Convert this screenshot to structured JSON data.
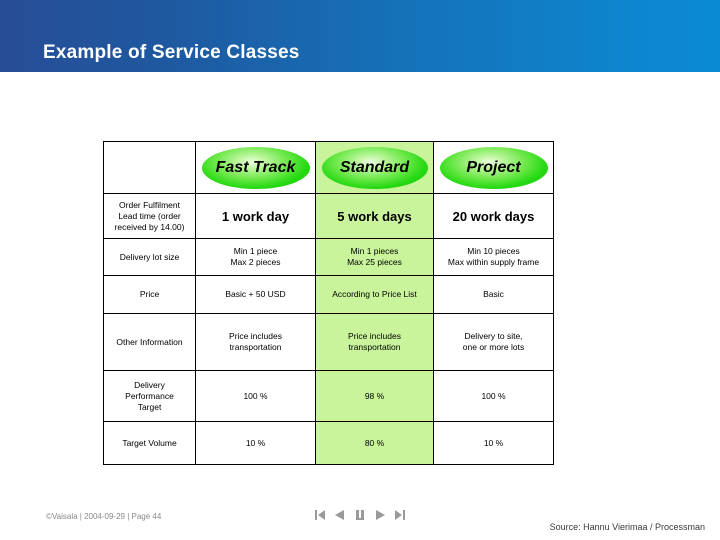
{
  "slide": {
    "title": "Example of Service Classes"
  },
  "table": {
    "columns": [
      "Fast Track",
      "Standard",
      "Project"
    ],
    "highlight_column": "Standard",
    "highlight_color": "#c9f49b",
    "pill_color": "#25d912",
    "rows": [
      {
        "label": "Order Fulfilment Lead time (order received by 14.00)",
        "label_lines": [
          "Order Fulfilment",
          "Lead time (order",
          "received by 14.00)"
        ],
        "emphasis": true,
        "cells": [
          {
            "lines": [
              "1 work day"
            ]
          },
          {
            "lines": [
              "5 work days"
            ]
          },
          {
            "lines": [
              "20 work days"
            ]
          }
        ]
      },
      {
        "label": "Delivery lot size",
        "label_lines": [
          "Delivery lot size"
        ],
        "emphasis": false,
        "cells": [
          {
            "lines": [
              "Min 1 piece",
              "Max 2 pieces"
            ]
          },
          {
            "lines": [
              "Min 1 pieces",
              "Max 25 pieces"
            ]
          },
          {
            "lines": [
              "Min 10 pieces",
              "Max within supply frame"
            ]
          }
        ]
      },
      {
        "label": "Price",
        "label_lines": [
          "Price"
        ],
        "emphasis": false,
        "cells": [
          {
            "lines": [
              "Basic + 50 USD"
            ]
          },
          {
            "lines": [
              "According to Price List"
            ]
          },
          {
            "lines": [
              "Basic"
            ]
          }
        ]
      },
      {
        "label": "Other Information",
        "label_lines": [
          "Other Information"
        ],
        "emphasis": false,
        "cells": [
          {
            "lines": [
              "Price includes",
              "transportation"
            ]
          },
          {
            "lines": [
              "Price includes",
              "transportation"
            ]
          },
          {
            "lines": [
              "Delivery to site,",
              "one or more lots"
            ]
          }
        ]
      },
      {
        "label": "Delivery Performance Target",
        "label_lines": [
          "Delivery",
          "Performance",
          "Target"
        ],
        "emphasis": false,
        "cells": [
          {
            "lines": [
              "100 %"
            ]
          },
          {
            "lines": [
              "98 %"
            ]
          },
          {
            "lines": [
              "100 %"
            ]
          }
        ]
      },
      {
        "label": "Target Volume",
        "label_lines": [
          "Target Volume"
        ],
        "emphasis": false,
        "cells": [
          {
            "lines": [
              "10 %"
            ]
          },
          {
            "lines": [
              "80 %"
            ]
          },
          {
            "lines": [
              "10 %"
            ]
          }
        ]
      }
    ]
  },
  "footer": {
    "credit": "©Vaisala | 2004-09-29 | Page 44",
    "source": "Source: Hannu Vierimaa / Processman",
    "nav": [
      {
        "name": "first-slide-icon",
        "glyph": "first"
      },
      {
        "name": "previous-slide-icon",
        "glyph": "previous"
      },
      {
        "name": "pause-slide-icon",
        "glyph": "pause"
      },
      {
        "name": "next-slide-icon",
        "glyph": "next"
      },
      {
        "name": "last-slide-icon",
        "glyph": "last"
      }
    ]
  },
  "colors": {
    "banner_start": "#274d96",
    "banner_end": "#0b8ad4",
    "title_text": "#ffffff",
    "table_border": "#000000"
  }
}
